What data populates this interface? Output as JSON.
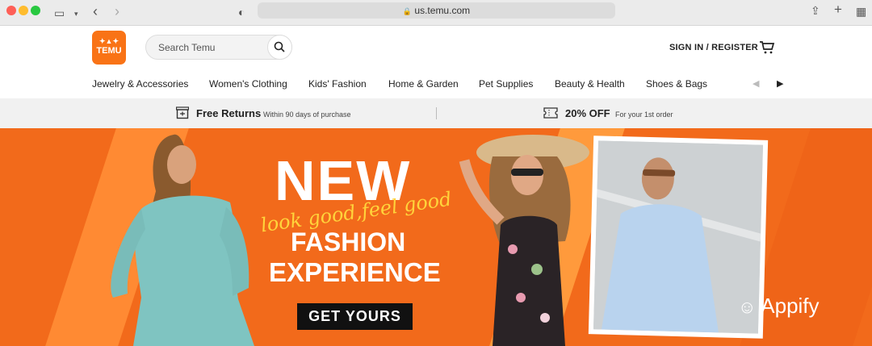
{
  "browser": {
    "url": "us.temu.com"
  },
  "header": {
    "logo_text": "TEMU",
    "search_placeholder": "Search Temu",
    "signin_label": "SIGN IN / REGISTER"
  },
  "nav": {
    "items": [
      "Jewelry & Accessories",
      "Women's Clothing",
      "Kids' Fashion",
      "Home & Garden",
      "Pet Supplies",
      "Beauty & Health",
      "Shoes & Bags"
    ]
  },
  "promo": {
    "returns_title": "Free Returns",
    "returns_sub": "Within 90 days of purchase",
    "discount_title": "20% OFF",
    "discount_sub": "For your 1st order"
  },
  "banner": {
    "headline": "NEW",
    "script_text": "look good,feel good",
    "line1": "FASHION",
    "line2": "EXPERIENCE",
    "cta_label": "GET YOURS",
    "accent": "#f26a1b"
  },
  "watermark": {
    "text": "Appify"
  }
}
